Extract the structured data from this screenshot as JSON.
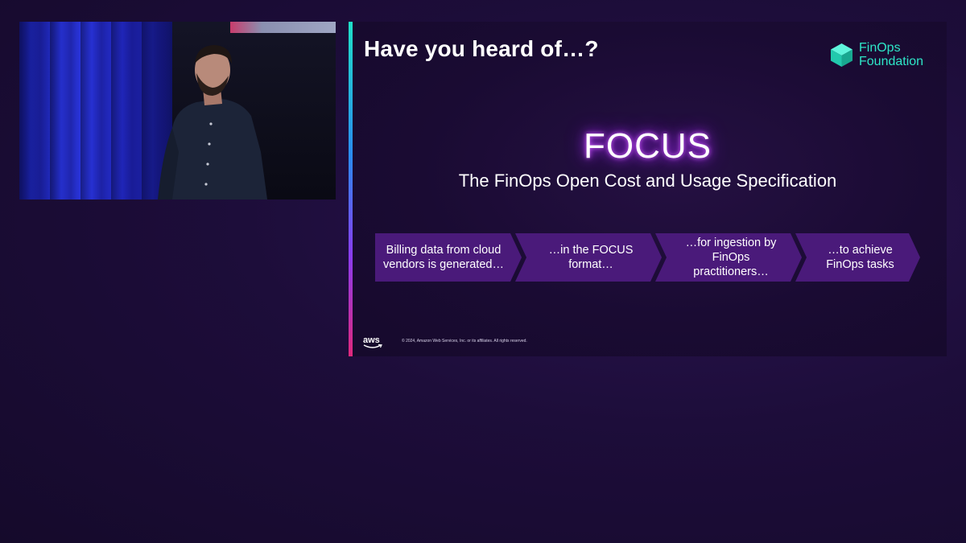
{
  "video": {
    "description_icon": "speaker-video"
  },
  "slide": {
    "title": "Have you heard of…?",
    "logo": {
      "line1": "FinOps",
      "line2": "Foundation",
      "icon": "cube-icon",
      "color": "#2ee6c8"
    },
    "focus_title": "FOCUS",
    "focus_subtitle": "The FinOps Open Cost and Usage Specification",
    "steps": [
      {
        "label": "Billing data from cloud\nvendors is generated…"
      },
      {
        "label": "…in the FOCUS\nformat…"
      },
      {
        "label": "…for ingestion by\nFinOps\npractitioners…"
      },
      {
        "label": "…to achieve\nFinOps tasks"
      }
    ],
    "aws_logo": "aws",
    "copyright": "© 2024, Amazon Web Services, Inc. or its affiliates. All rights reserved."
  },
  "colors": {
    "background": "#1d0d3a",
    "chevron_fill": "#4a1a7a",
    "focus_glow": "#b030ff",
    "accent_top": "#1fe0c8",
    "accent_bottom": "#e0287c"
  }
}
